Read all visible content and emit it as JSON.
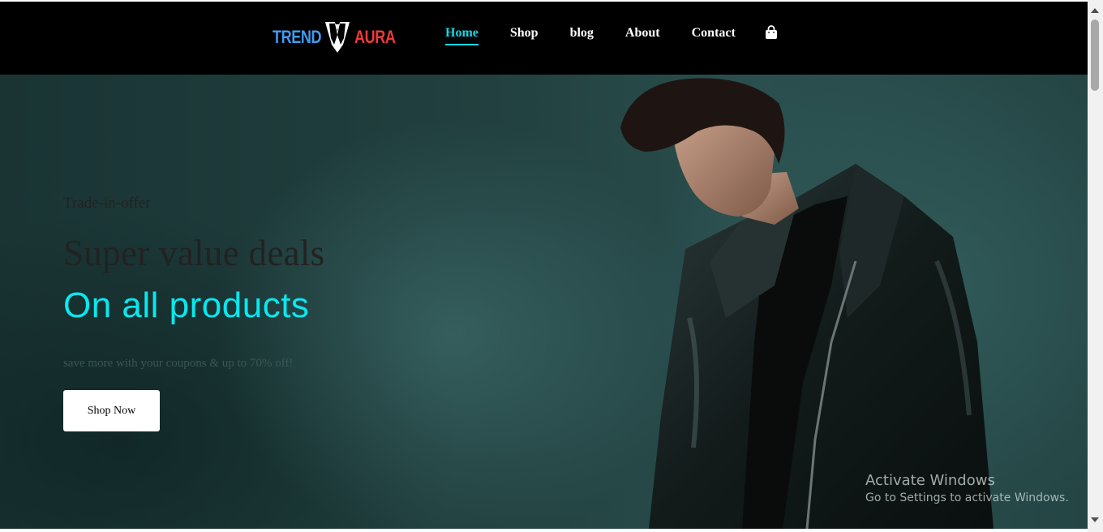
{
  "brand": {
    "word1": "TREND",
    "word2": "AURA"
  },
  "nav": {
    "items": [
      {
        "label": "Home",
        "active": true
      },
      {
        "label": "Shop"
      },
      {
        "label": "blog"
      },
      {
        "label": "About"
      },
      {
        "label": "Contact"
      }
    ],
    "cart_icon": "shopping-bag-icon"
  },
  "hero": {
    "tagline": "Trade-in-offer",
    "headline": "Super value deals",
    "highlight": "On all products",
    "subtext": "save more with your coupons & up to 70% off!",
    "cta_label": "Shop Now"
  },
  "watermark": {
    "line1": "Activate Windows",
    "line2": "Go to Settings to activate Windows."
  },
  "colors": {
    "accent": "#11d8e6",
    "brand_blue": "#3f9bf0",
    "brand_red": "#ee3a3a",
    "header_bg": "#000000"
  }
}
